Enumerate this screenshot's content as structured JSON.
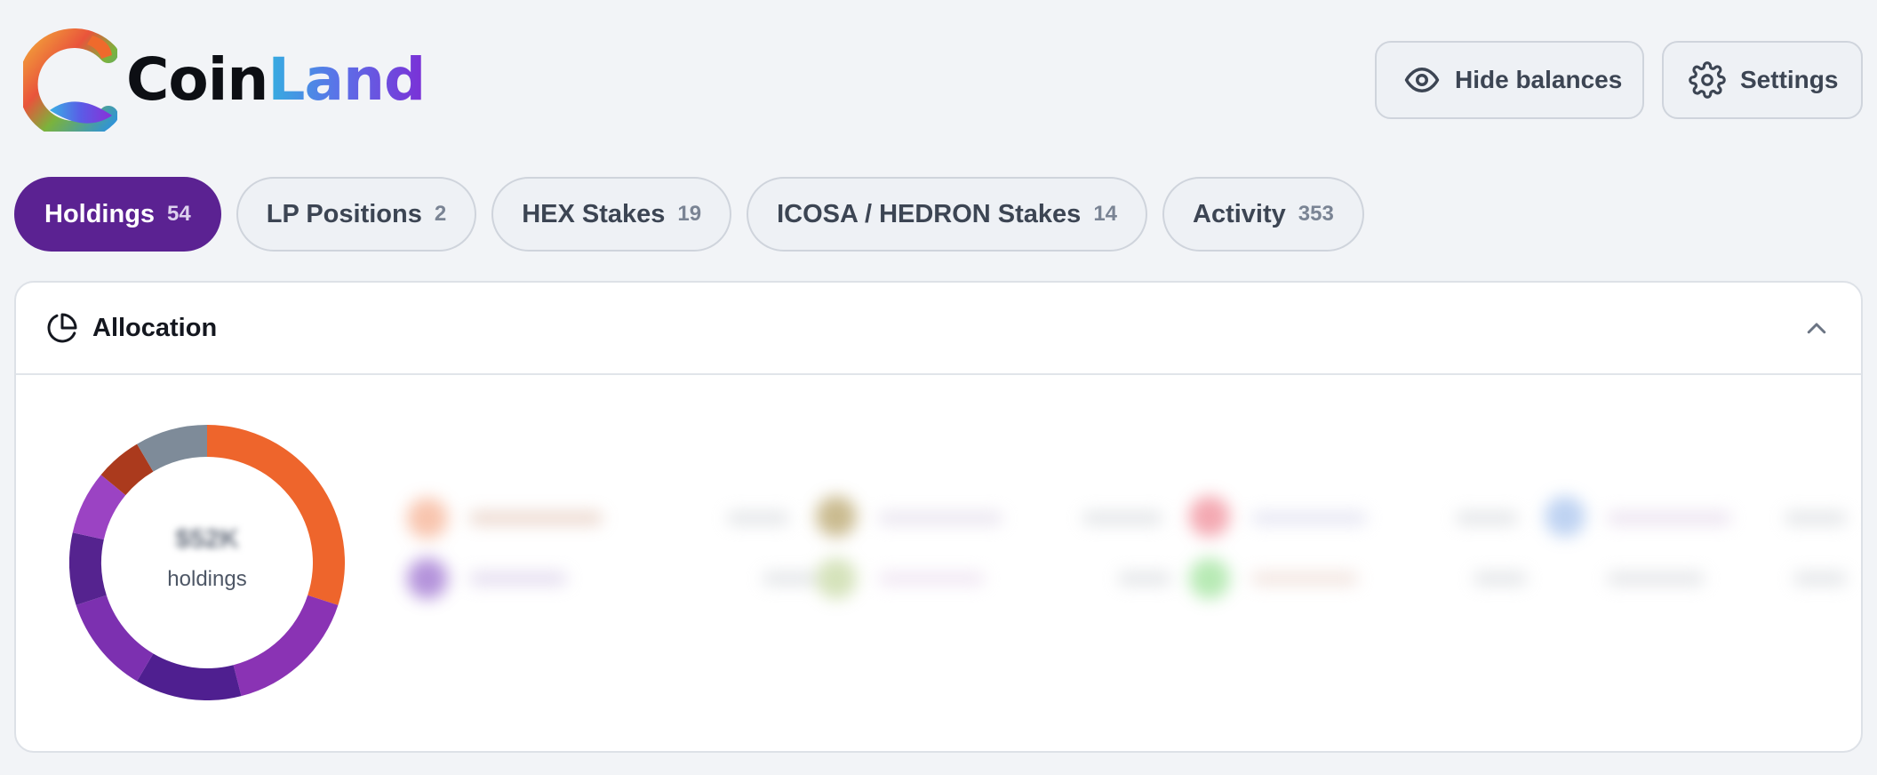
{
  "brand": {
    "name_part1": "Coin",
    "name_part2": "Land",
    "logo_icon": "coinland-logo-icon"
  },
  "header": {
    "hide_balances": {
      "label": "Hide balances",
      "icon": "eye-icon"
    },
    "settings": {
      "label": "Settings",
      "icon": "gear-icon"
    }
  },
  "tabs": [
    {
      "label": "Holdings",
      "count": "54",
      "active": true
    },
    {
      "label": "LP Positions",
      "count": "2",
      "active": false
    },
    {
      "label": "HEX Stakes",
      "count": "19",
      "active": false
    },
    {
      "label": "ICOSA / HEDRON Stakes",
      "count": "14",
      "active": false
    },
    {
      "label": "Activity",
      "count": "353",
      "active": false
    }
  ],
  "allocation": {
    "title": "Allocation",
    "icon": "pie-chart-icon",
    "collapse_icon": "chevron-up-icon",
    "total_value": "$52K",
    "total_label": "holdings",
    "segments": [
      {
        "share": 0.3,
        "color": "#ee652c"
      },
      {
        "share": 0.16,
        "color": "#8a33b4"
      },
      {
        "share": 0.125,
        "color": "#4f1f90"
      },
      {
        "share": 0.115,
        "color": "#7c30b0"
      },
      {
        "share": 0.085,
        "color": "#55238f"
      },
      {
        "share": 0.075,
        "color": "#9b43c3"
      },
      {
        "share": 0.055,
        "color": "#ab3a1d"
      },
      {
        "share": 0.085,
        "color": "#7e8b99"
      }
    ]
  },
  "colors": {
    "accent": "#5b2292",
    "background": "#f2f4f7",
    "card": "#ffffff",
    "border": "#cfd4dc"
  }
}
